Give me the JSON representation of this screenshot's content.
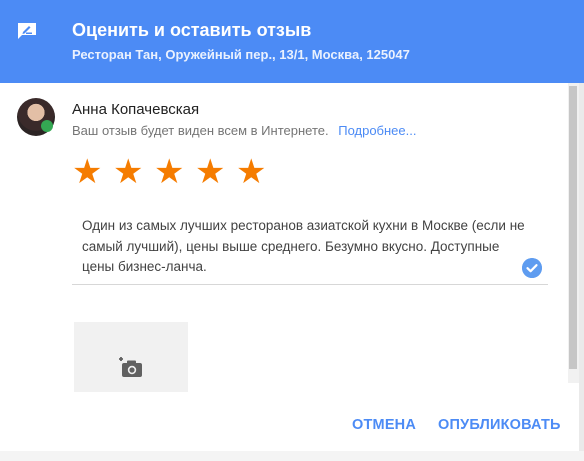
{
  "dialog": {
    "title": "Оценить и оставить отзыв",
    "subtitle": "Ресторан Тан, Оружейный пер., 13/1, Москва, 125047",
    "icon": "edit-review-icon"
  },
  "user": {
    "name": "Анна Копачевская",
    "visibility_note": "Ваш отзыв будет виден всем в Интернете.",
    "more_link": "Подробнее..."
  },
  "rating": {
    "value": 5,
    "max": 5,
    "star_glyph": "★",
    "color": "#f57c00"
  },
  "review": {
    "text": "Один из самых лучших ресторанов азиатской кухни в Москве (если не самый лучший), цены выше среднего. Безумно вкусно. Доступные цены бизнес-ланча."
  },
  "photo": {
    "icon": "add-photo-icon"
  },
  "actions": {
    "cancel_label": "ОТМЕНА",
    "publish_label": "ОПУБЛИКОВАТЬ"
  },
  "colors": {
    "header": "#4c8bf5",
    "accent": "#4c8bf5"
  }
}
